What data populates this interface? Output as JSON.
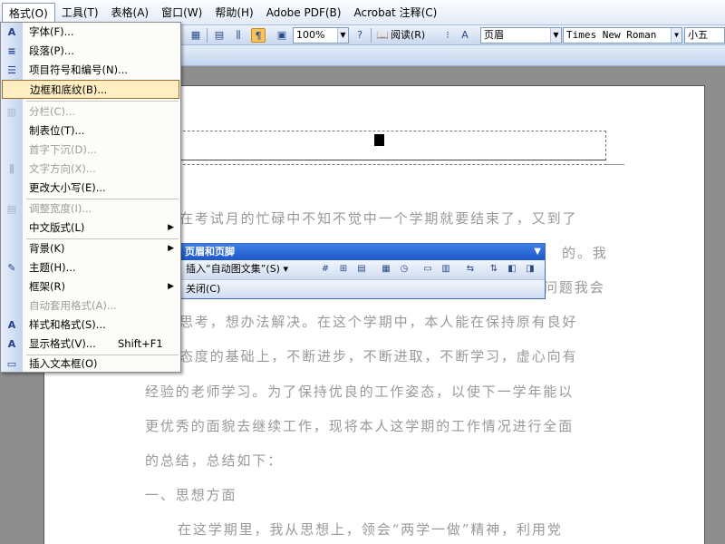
{
  "menubar": {
    "items": [
      "格式(O)",
      "工具(T)",
      "表格(A)",
      "窗口(W)",
      "帮助(H)",
      "Adobe PDF(B)",
      "Acrobat 注释(C)"
    ]
  },
  "toolbar": {
    "zoom": "100%",
    "reading": "阅读(R)",
    "style": "页眉",
    "font": "Times New Roman",
    "size": "小五"
  },
  "format_menu": {
    "items": [
      {
        "label": "字体(F)...",
        "icon": "font-icon",
        "glyph": "A",
        "enabled": true
      },
      {
        "label": "段落(P)...",
        "icon": "paragraph-icon",
        "glyph": "≡",
        "enabled": true
      },
      {
        "label": "项目符号和编号(N)...",
        "icon": "bullets-icon",
        "glyph": "☰",
        "enabled": true
      },
      {
        "label": "边框和底纹(B)...",
        "icon": "",
        "glyph": "",
        "enabled": true,
        "highlight": true
      },
      {
        "label": "分栏(C)...",
        "icon": "columns-icon",
        "glyph": "▥",
        "enabled": false
      },
      {
        "label": "制表位(T)...",
        "icon": "",
        "glyph": "",
        "enabled": true
      },
      {
        "label": "首字下沉(D)...",
        "icon": "",
        "glyph": "",
        "enabled": false
      },
      {
        "label": "文字方向(X)...",
        "icon": "text-direction-icon",
        "glyph": "⫼",
        "enabled": false
      },
      {
        "label": "更改大小写(E)...",
        "icon": "",
        "glyph": "",
        "enabled": true
      },
      {
        "label": "调整宽度(I)...",
        "icon": "fit-width-icon",
        "glyph": "▤",
        "enabled": false
      },
      {
        "label": "中文版式(L)",
        "icon": "",
        "glyph": "",
        "enabled": true,
        "submenu": true
      },
      {
        "label": "背景(K)",
        "icon": "",
        "glyph": "",
        "enabled": true,
        "submenu": true
      },
      {
        "label": "主题(H)...",
        "icon": "theme-icon",
        "glyph": "✎",
        "enabled": true
      },
      {
        "label": "框架(R)",
        "icon": "",
        "glyph": "",
        "enabled": true,
        "submenu": true
      },
      {
        "label": "自动套用格式(A)...",
        "icon": "",
        "glyph": "",
        "enabled": false
      },
      {
        "label": "样式和格式(S)...",
        "icon": "styles-icon",
        "glyph": "A",
        "enabled": true
      },
      {
        "label": "显示格式(V)...",
        "shortcut": "Shift+F1",
        "icon": "reveal-formatting-icon",
        "glyph": "A",
        "enabled": true
      },
      {
        "label": "插入文本框(O)",
        "icon": "textbox-icon",
        "glyph": "▭",
        "enabled": true
      }
    ],
    "shortcut_reveal": "Shift+F1"
  },
  "hf_toolbar": {
    "title": "页眉和页脚",
    "insert_autotext": "插入“自动图文集”(S)",
    "close": "关闭(C)"
  },
  "document": {
    "lines": [
      "在考试月的忙碌中不知不觉中一个学期就要结束了，又到了",
      "的。我",
      "问题我会",
      "思考，想办法解决。在这个学期中，本人能在保持原有良好",
      "态度的基础上，不断进步，不断进取，不断学习，虚心向有",
      "经验的老师学习。为了保持优良的工作姿态，以使下一学年能以",
      "更优秀的面貌去继续工作，现将本人这学期的工作情况进行全面",
      "的总结，总结如下：",
      "一、思想方面",
      "在这学期里，我从思想上，领会“两学一做”精神，利用党"
    ]
  }
}
